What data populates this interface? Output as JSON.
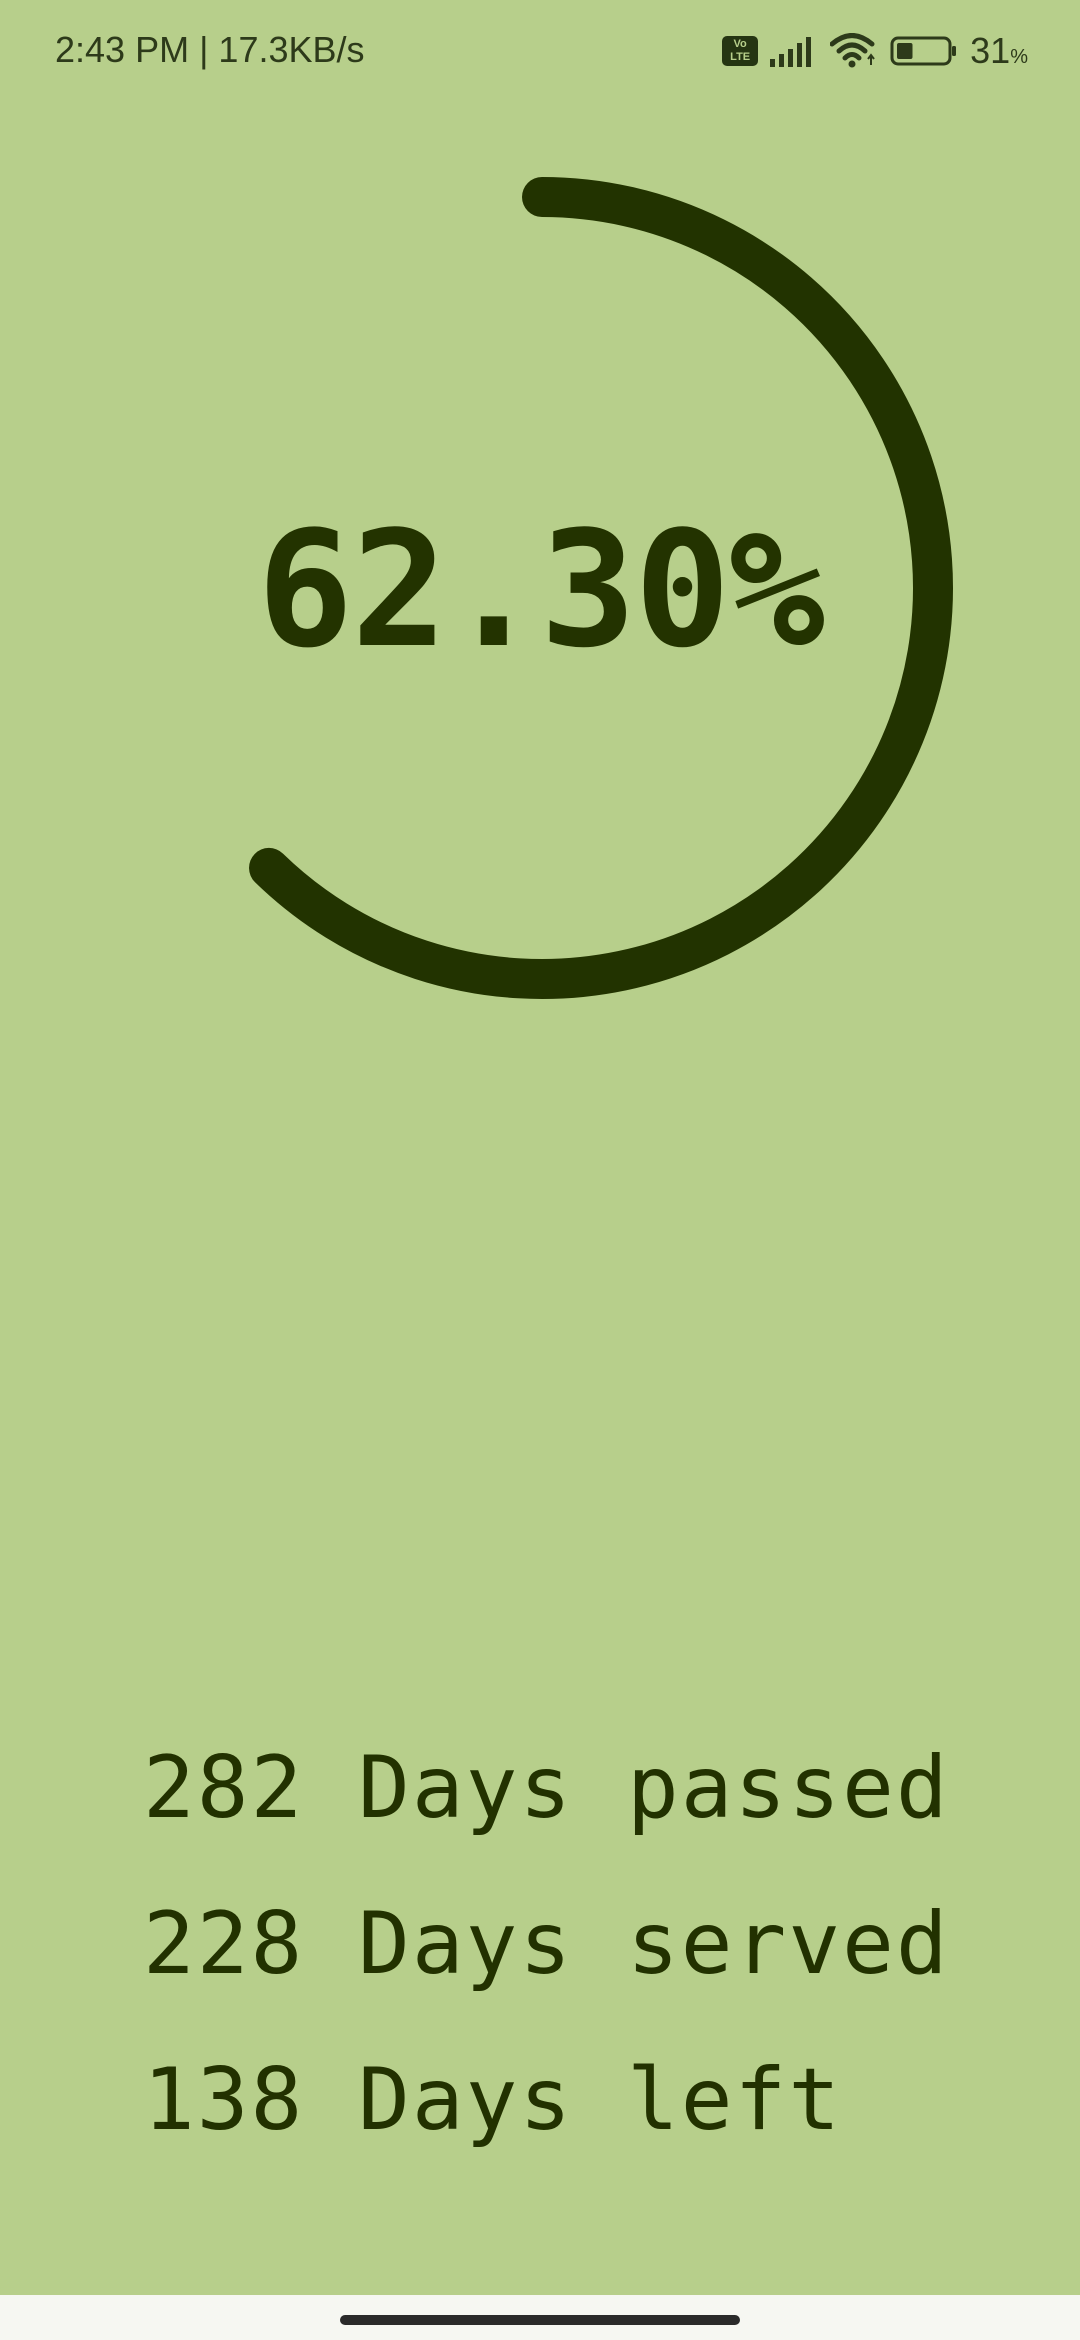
{
  "status_bar": {
    "time_speed": "2:43 PM | 17.3KB/s",
    "volte_top": "Vo",
    "volte_bottom": "LTE",
    "signal_icon": "signal-bars-icon",
    "wifi_icon": "wifi-icon",
    "battery_icon": "battery-icon",
    "battery_level": 0.31,
    "battery_number": "31",
    "battery_unit": "%"
  },
  "progress": {
    "label": "62.30%",
    "fraction": 0.623,
    "ring_color": "#223300",
    "background_color": "#b7cf8b"
  },
  "stats": {
    "passed": "282 Days passed",
    "served": "228 Days served",
    "left": "138 Days left"
  }
}
